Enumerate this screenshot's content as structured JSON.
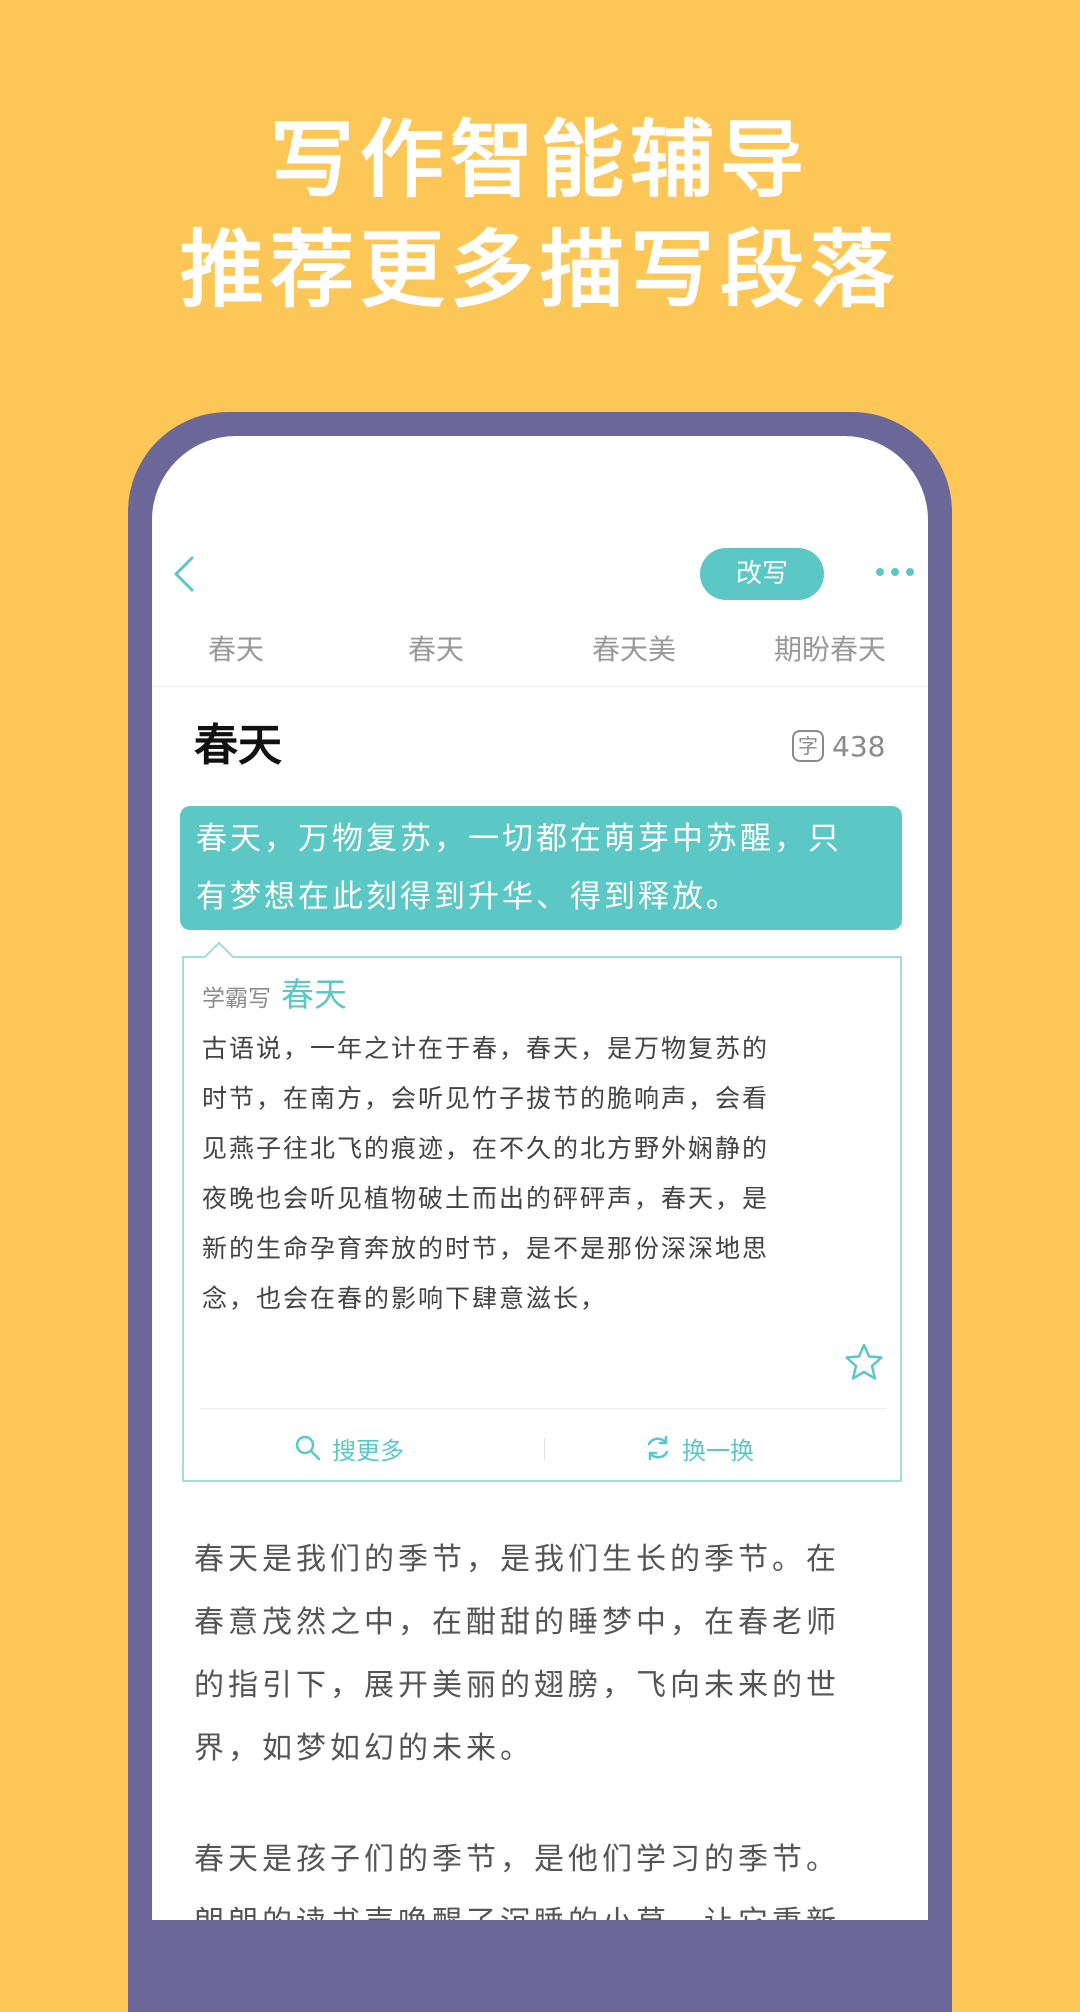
{
  "headline": {
    "line1": "写作智能辅导",
    "line2": "推荐更多描写段落"
  },
  "header": {
    "rewrite_label": "改写"
  },
  "tabs": [
    {
      "label": "春天"
    },
    {
      "label": "春天"
    },
    {
      "label": "春天美"
    },
    {
      "label": "期盼春天"
    }
  ],
  "article": {
    "title": "春天",
    "word_count_icon": "字",
    "word_count": "438",
    "highlight_line1": "春天，万物复苏，一切都在萌芽中苏醒，只",
    "highlight_line2": "有梦想在此刻得到升华、得到释放。"
  },
  "suggestion_card": {
    "source_label": "学霸写",
    "source_topic": "春天",
    "lines": [
      "古语说，一年之计在于春，春天，是万物复苏的",
      "时节，在南方，会听见竹子拔节的脆响声，会看",
      "见燕子往北飞的痕迹，在不久的北方野外娴静的",
      "夜晚也会听见植物破土而出的砰砰声，春天，是",
      "新的生命孕育奔放的时节，是不是那份深深地思",
      "念，也会在春的影响下肆意滋长，"
    ],
    "search_more_label": "搜更多",
    "swap_label": "换一换"
  },
  "paragraphs": {
    "p1": [
      "春天是我们的季节，是我们生长的季节。在",
      "春意茂然之中，在酣甜的睡梦中，在春老师",
      "的指引下，展开美丽的翅膀，飞向未来的世",
      "界，如梦如幻的未来。"
    ],
    "p2": [
      "春天是孩子们的季节，是他们学习的季节。",
      "朗朗的读书声唤醒了沉睡的小草，让它重新"
    ]
  },
  "colors": {
    "background": "#fcc757",
    "accent": "#5bc8c5",
    "phone_frame": "#6b6899"
  },
  "icons": [
    "back-icon",
    "more-icon",
    "star-icon",
    "search-icon",
    "refresh-icon"
  ]
}
